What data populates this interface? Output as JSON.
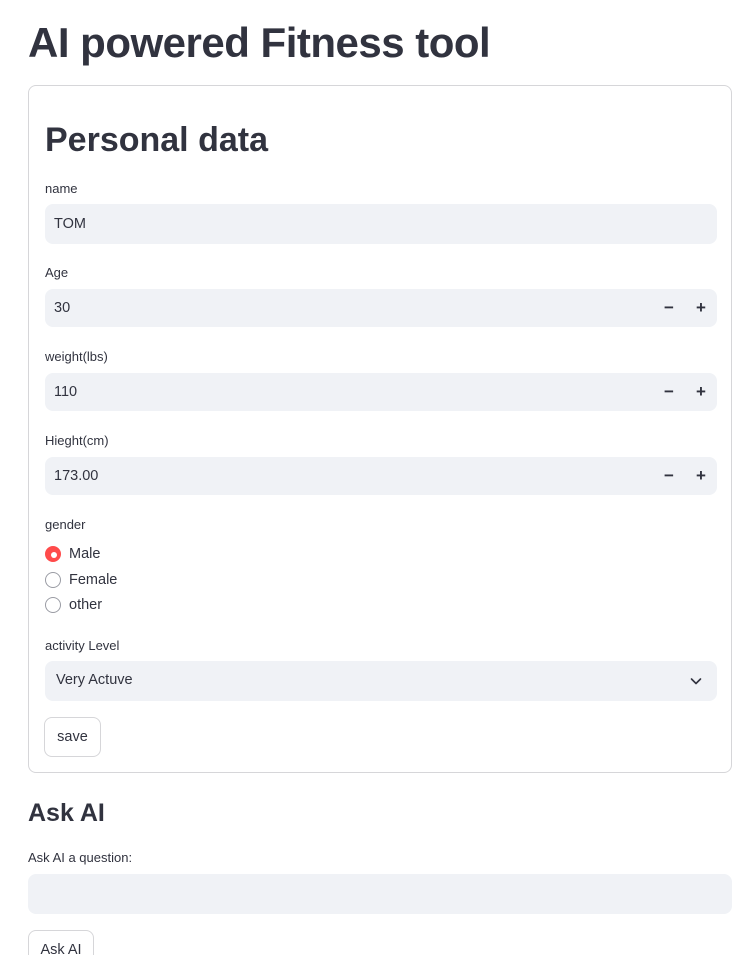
{
  "page": {
    "title": "AI powered Fitness tool"
  },
  "form": {
    "title": "Personal data",
    "name": {
      "label": "name",
      "value": "TOM"
    },
    "age": {
      "label": "Age",
      "value": "30",
      "minus": "−",
      "plus": "+"
    },
    "weight": {
      "label": "weight(lbs)",
      "value": "110",
      "minus": "−",
      "plus": "+"
    },
    "height": {
      "label": "Hieght(cm)",
      "value": "173.00",
      "minus": "−",
      "plus": "+"
    },
    "gender": {
      "label": "gender",
      "options": [
        {
          "label": "Male",
          "selected": true
        },
        {
          "label": "Female",
          "selected": false
        },
        {
          "label": "other",
          "selected": false
        }
      ]
    },
    "activity": {
      "label": "activity Level",
      "value": "Very Actuve",
      "icon": "chevron-down-icon"
    },
    "save_label": "save"
  },
  "ask": {
    "title": "Ask AI",
    "question_label": "Ask AI a question:",
    "question_value": "",
    "button_label": "Ask AI"
  },
  "colors": {
    "accent": "#ff4b4b",
    "input_bg": "#f0f2f6",
    "text": "#31333f",
    "border": "#d6d6d9"
  }
}
